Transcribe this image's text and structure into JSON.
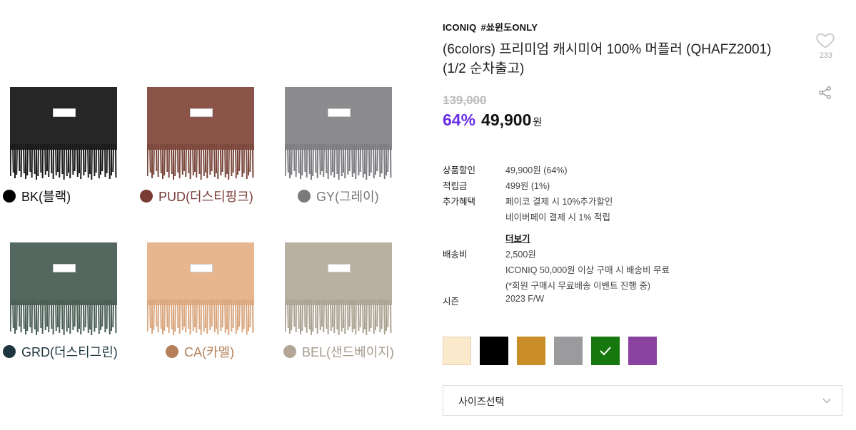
{
  "gallery": {
    "items": [
      {
        "code": "BK(블랙)",
        "body": "#262626",
        "fringe": "#1a1a1a",
        "dot": "#000000",
        "text": "#111111"
      },
      {
        "code": "PUD(더스티핑크)",
        "body": "#8a5448",
        "fringe": "#7a473c",
        "dot": "#7a3b35",
        "text": "#7a3b35"
      },
      {
        "code": "GY(그레이)",
        "body": "#8c8c8f",
        "fringe": "#7c7c80",
        "dot": "#7a7a7a",
        "text": "#777777"
      },
      {
        "code": "GRD(더스티그린)",
        "body": "#54685f",
        "fringe": "#4a5e55",
        "dot": "#1e3540",
        "text": "#1e3540"
      },
      {
        "code": "CA(카멜)",
        "body": "#e7b68e",
        "fringe": "#d9a67e",
        "dot": "#b5805a",
        "text": "#b5805a"
      },
      {
        "code": "BEL(샌드베이지)",
        "body": "#b8b1a1",
        "fringe": "#aaa392",
        "dot": "#b3a696",
        "text": "#a59a8c"
      }
    ]
  },
  "product": {
    "brand": "ICONIQ",
    "tag": "#쑈윈도ONLY",
    "title_line1": "(6colors) 프리미엄 캐시미어 100% 머플러 (QHAFZ2001)",
    "title_line2": "(1/2 순차출고)",
    "like_count": "233",
    "original_price": "139,000",
    "discount": "64%",
    "price": "49,900",
    "currency": "원"
  },
  "details": {
    "discount_label": "상품할인",
    "discount_value": "49,900원 (64%)",
    "points_label": "적립금",
    "points_value": "499원 (1%)",
    "benefit_label": "추가혜택",
    "benefit_1": "페이코 결제 시 10%추가할인",
    "benefit_2": "네이버페이 결제 시 1% 적립",
    "more": "더보기",
    "shipping_label": "배송비",
    "shipping_1": "2,500원",
    "shipping_2": "ICONIQ 50,000원 이상 구매 시 배송비 무료",
    "shipping_3": "(*회원 구매시 무료배송 이벤트 진행 중)",
    "season_label": "시즌",
    "season_value": "2023 F/W"
  },
  "color_options": [
    {
      "color": "#fbe9cc",
      "selected": false
    },
    {
      "color": "#000000",
      "selected": false
    },
    {
      "color": "#c98e27",
      "selected": false
    },
    {
      "color": "#9b9b9e",
      "selected": false
    },
    {
      "color": "#17780f",
      "selected": true
    },
    {
      "color": "#8942a0",
      "selected": false
    }
  ],
  "size_select": {
    "label": "사이즈선택"
  }
}
